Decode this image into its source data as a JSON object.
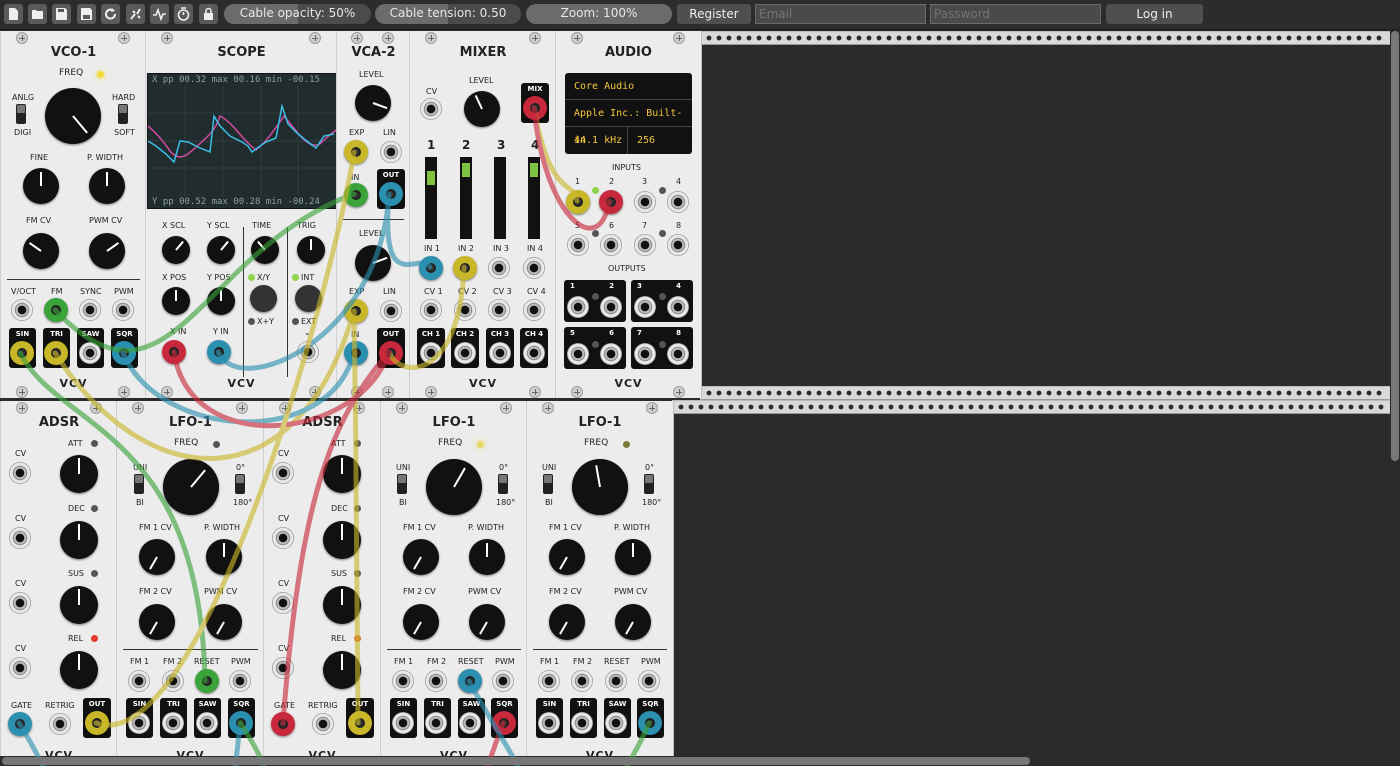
{
  "toolbar": {
    "icons": [
      "new-file-icon",
      "open-folder-icon",
      "save-icon",
      "save-as-icon",
      "revert-icon",
      "disconnect-cables-icon",
      "cpu-meter-icon",
      "power-meter-icon",
      "lock-icon"
    ],
    "cable_opacity": {
      "label": "Cable opacity: 50%",
      "value": 0.5
    },
    "cable_tension": {
      "label": "Cable tension: 0.50",
      "value": 0.5
    },
    "zoom": {
      "label": "Zoom: 100%",
      "value": 1.0
    },
    "register_label": "Register",
    "email_placeholder": "Email",
    "password_placeholder": "Password",
    "login_label": "Log in"
  },
  "brand": "VCV",
  "vco": {
    "title": "VCO-1",
    "freq": "FREQ",
    "anlg": "ANLG",
    "digi": "DIGI",
    "hard": "HARD",
    "soft": "SOFT",
    "fine": "FINE",
    "pwidth": "P. WIDTH",
    "fmcv": "FM CV",
    "pwmcv": "PWM CV",
    "voct": "V/OCT",
    "fm": "FM",
    "sync": "SYNC",
    "pwm": "PWM",
    "sin": "SIN",
    "tri": "TRI",
    "saw": "SAW",
    "sqr": "SQR"
  },
  "scope": {
    "title": "SCOPE",
    "top": "X  pp 00.32  max 00.16  min -00.15",
    "bottom": "Y  pp 00.52  max 00.28  min -00.24",
    "xscl": "X SCL",
    "yscl": "Y SCL",
    "time": "TIME",
    "trig": "TRIG",
    "xpos": "X POS",
    "ypos": "Y POS",
    "xy": "X/Y",
    "xplusy": "X+Y",
    "int": "INT",
    "ext": "EXT",
    "xin": "X IN",
    "yin": "Y IN"
  },
  "vca": {
    "title": "VCA-2",
    "level": "LEVEL",
    "exp": "EXP",
    "lin": "LIN",
    "in": "IN",
    "out": "OUT"
  },
  "mixer": {
    "title": "MIXER",
    "cv": "CV",
    "level": "LEVEL",
    "mix": "MIX",
    "ch": [
      "1",
      "2",
      "3",
      "4"
    ],
    "in": [
      "IN 1",
      "IN 2",
      "IN 3",
      "IN 4"
    ],
    "cvs": [
      "CV 1",
      "CV 2",
      "CV 3",
      "CV 4"
    ],
    "chout": [
      "CH 1",
      "CH 2",
      "CH 3",
      "CH 4"
    ]
  },
  "audio": {
    "title": "AUDIO",
    "driver": "Core Audio",
    "device": "Apple Inc.: Built-in",
    "rate": "44.1 kHz",
    "block": "256",
    "inputs": "INPUTS",
    "outputs": "OUTPUTS",
    "nums": [
      "1",
      "2",
      "3",
      "4",
      "5",
      "6",
      "7",
      "8"
    ]
  },
  "adsr": {
    "title": "ADSR",
    "cv": "CV",
    "att": "ATT",
    "dec": "DEC",
    "sus": "SUS",
    "rel": "REL",
    "gate": "GATE",
    "retrig": "RETRIG",
    "out": "OUT"
  },
  "lfo": {
    "title": "LFO-1",
    "freq": "FREQ",
    "uni": "UNI",
    "bi": "BI",
    "deg0": "0°",
    "deg180": "180°",
    "fm1cv": "FM 1 CV",
    "pwidth": "P. WIDTH",
    "fm2cv": "FM 2 CV",
    "pwmcv": "PWM CV",
    "fm1": "FM 1",
    "fm2": "FM 2",
    "reset": "RESET",
    "pwm": "PWM",
    "sin": "SIN",
    "tri": "TRI",
    "saw": "SAW",
    "sqr": "SQR"
  },
  "colors": {
    "yellow": "#c9b72a",
    "green": "#3aa33a",
    "blue": "#2b8fb0",
    "red": "#c8283c",
    "led_yellow": "#f3d93a",
    "led_red": "#e23a2a",
    "led_green": "#8fd44a"
  }
}
